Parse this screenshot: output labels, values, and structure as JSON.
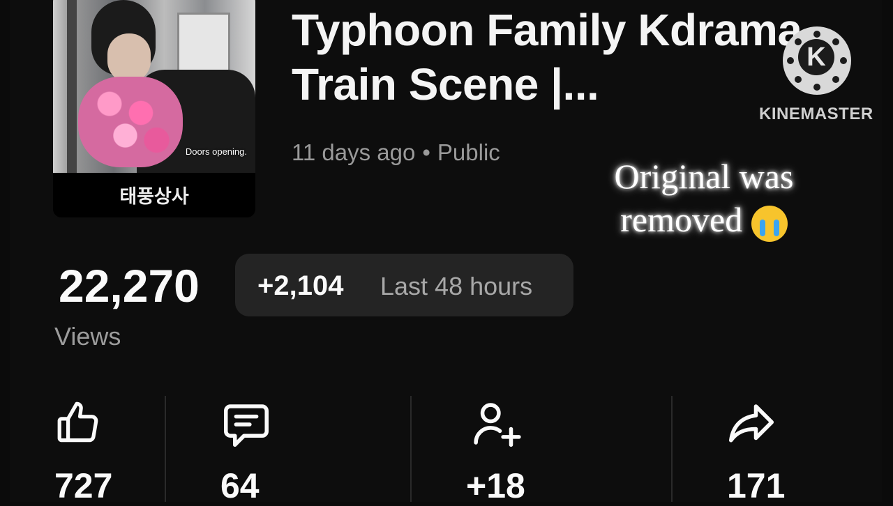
{
  "thumbnail": {
    "subtitle": "Doors opening.",
    "caption": "태풍상사"
  },
  "video": {
    "title": "Typhoon Family Kdrama Train Scene |...",
    "age": "11 days ago",
    "separator": "•",
    "visibility": "Public"
  },
  "watermark": {
    "logo_letter": "K",
    "text": "KINEMASTER"
  },
  "overlay": {
    "line1": "Original was",
    "line2": "removed",
    "emoji": "loudly-crying-face"
  },
  "views": {
    "count": "22,270",
    "label": "Views",
    "delta": "+2,104",
    "period": "Last 48 hours"
  },
  "metrics": [
    {
      "icon": "thumbs-up-icon",
      "value": "727"
    },
    {
      "icon": "comment-icon",
      "value": "64"
    },
    {
      "icon": "add-subscriber-icon",
      "value": "+18"
    },
    {
      "icon": "share-icon",
      "value": "171"
    }
  ],
  "colors": {
    "background": "#0d0d0d",
    "pill": "#242424",
    "muted_text": "#9a9a9a"
  }
}
